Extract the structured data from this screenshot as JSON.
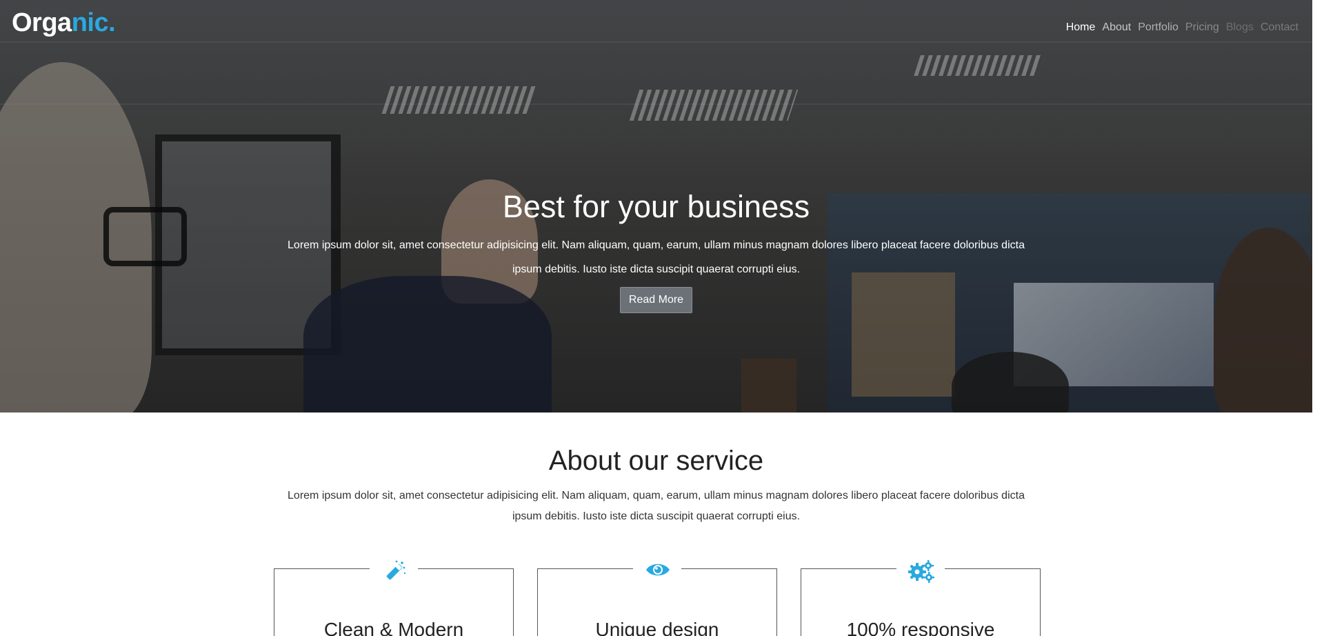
{
  "brand": {
    "prefix": "Orga",
    "suffix": "nic.",
    "accent_color": "#29a9e0"
  },
  "nav": {
    "items": [
      {
        "label": "Home"
      },
      {
        "label": "About"
      },
      {
        "label": "Portfolio"
      },
      {
        "label": "Pricing"
      },
      {
        "label": "Blogs"
      },
      {
        "label": "Contact"
      }
    ]
  },
  "hero": {
    "title": "Best for your business",
    "text": "Lorem ipsum dolor sit, amet consectetur adipisicing elit. Nam aliquam, quam, earum, ullam minus magnam dolores libero placeat facere doloribus dicta ipsum debitis. Iusto iste dicta suscipit quaerat corrupti eius.",
    "button_label": "Read More"
  },
  "about": {
    "title": "About our service",
    "text": "Lorem ipsum dolor sit, amet consectetur adipisicing elit. Nam aliquam, quam, earum, ullam minus magnam dolores libero placeat facere doloribus dicta ipsum debitis. Iusto iste dicta suscipit quaerat corrupti eius.",
    "features": [
      {
        "icon": "magic-wand-icon",
        "title": "Clean & Modern"
      },
      {
        "icon": "eye-icon",
        "title": "Unique design"
      },
      {
        "icon": "gears-icon",
        "title": "100% responsive"
      }
    ]
  }
}
